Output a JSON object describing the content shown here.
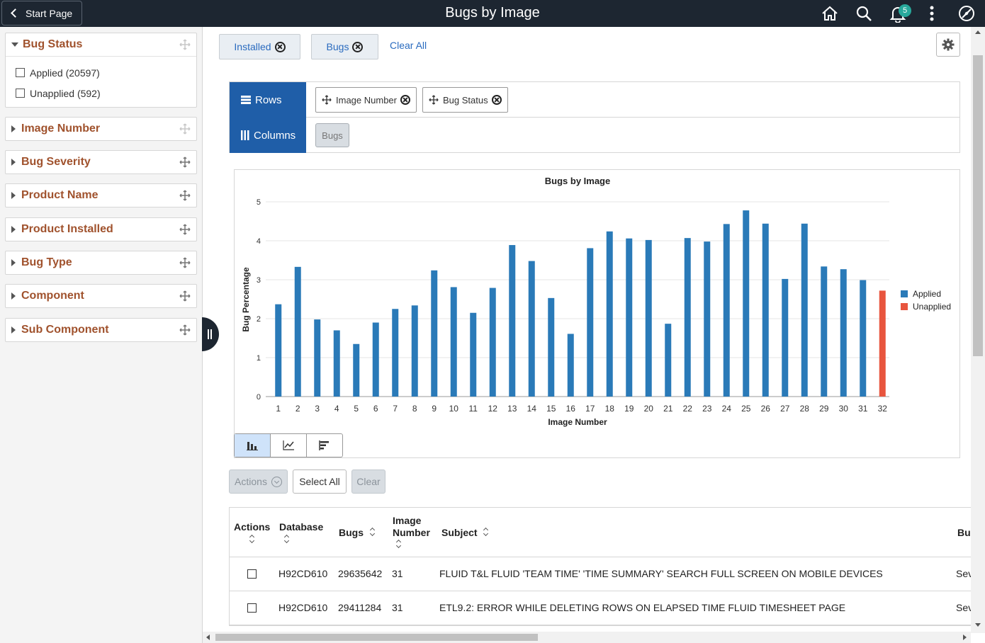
{
  "header": {
    "back_label": "Start Page",
    "title": "Bugs by Image",
    "notification_count": "5",
    "icons": [
      "home-icon",
      "search-icon",
      "bell-icon",
      "more-icon",
      "compass-icon"
    ]
  },
  "sidebar": {
    "facets": [
      {
        "label": "Bug Status",
        "expanded": true,
        "options": [
          {
            "label": "Applied (20597)",
            "checked": false
          },
          {
            "label": "Unapplied (592)",
            "checked": false
          }
        ]
      },
      {
        "label": "Image Number",
        "expanded": false
      },
      {
        "label": "Bug Severity",
        "expanded": false
      },
      {
        "label": "Product Name",
        "expanded": false
      },
      {
        "label": "Product Installed",
        "expanded": false
      },
      {
        "label": "Bug Type",
        "expanded": false
      },
      {
        "label": "Component",
        "expanded": false
      },
      {
        "label": "Sub Component",
        "expanded": false
      }
    ]
  },
  "filters": {
    "pills": [
      "Installed",
      "Bugs"
    ],
    "clear_all": "Clear All"
  },
  "pivot": {
    "rows_label": "Rows",
    "columns_label": "Columns",
    "row_fields": [
      "Image Number",
      "Bug Status"
    ],
    "column_fields": [
      "Bugs"
    ]
  },
  "chart_data": {
    "type": "bar",
    "title": "Bugs by Image",
    "xlabel": "Image Number",
    "ylabel": "Bug Percentage",
    "ylim": [
      0,
      5
    ],
    "yticks": [
      "0",
      "1",
      "2",
      "3",
      "4",
      "5"
    ],
    "categories": [
      "1",
      "2",
      "3",
      "4",
      "5",
      "6",
      "7",
      "8",
      "9",
      "10",
      "11",
      "12",
      "13",
      "14",
      "15",
      "16",
      "17",
      "18",
      "19",
      "20",
      "21",
      "22",
      "23",
      "24",
      "25",
      "26",
      "27",
      "28",
      "29",
      "30",
      "31",
      "32"
    ],
    "legend_position": "right",
    "series": [
      {
        "name": "Applied",
        "color": "#2a7ab8",
        "values": [
          2.37,
          3.33,
          1.98,
          1.7,
          1.35,
          1.9,
          2.25,
          2.34,
          3.24,
          2.81,
          2.15,
          2.79,
          3.89,
          3.48,
          2.53,
          1.61,
          3.81,
          4.24,
          4.06,
          4.02,
          1.87,
          4.07,
          3.98,
          4.43,
          4.78,
          4.44,
          3.02,
          4.44,
          3.34,
          3.27,
          2.99,
          null
        ]
      },
      {
        "name": "Unapplied",
        "color": "#e8553e",
        "values": [
          null,
          null,
          null,
          null,
          null,
          null,
          null,
          null,
          null,
          null,
          null,
          null,
          null,
          null,
          null,
          null,
          null,
          null,
          null,
          null,
          null,
          null,
          null,
          null,
          null,
          null,
          null,
          null,
          null,
          null,
          null,
          2.72
        ]
      }
    ]
  },
  "chart_toggle": {
    "selected": "bar",
    "icons": [
      "bar-chart-icon",
      "line-chart-icon",
      "horizontal-bar-icon"
    ]
  },
  "grid_actions": {
    "actions": "Actions",
    "select_all": "Select All",
    "clear": "Clear"
  },
  "grid": {
    "columns": [
      "Actions",
      "Database",
      "Bugs",
      "Image Number",
      "Subject",
      "Bu"
    ],
    "rows": [
      {
        "database": "H92CD610",
        "bugs": "29635642",
        "image": "31",
        "subject": "FLUID T&L FLUID 'TEAM TIME' 'TIME SUMMARY' SEARCH FULL SCREEN ON MOBILE DEVICES",
        "extra": "Sev"
      },
      {
        "database": "H92CD610",
        "bugs": "29411284",
        "image": "31",
        "subject": "ETL9.2: ERROR WHILE DELETING ROWS ON ELAPSED TIME FLUID TIMESHEET PAGE",
        "extra": "Sev"
      }
    ]
  }
}
